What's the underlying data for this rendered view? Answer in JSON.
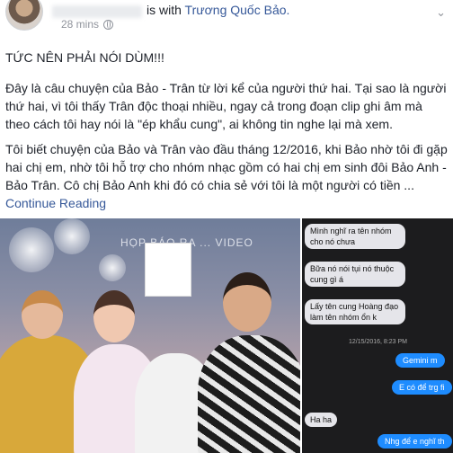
{
  "header": {
    "with_text": "is with",
    "tagged_name": "Trương Quốc Bảo.",
    "time": "28 mins"
  },
  "post": {
    "title": "TỨC NÊN PHẢI NÓI DÙM!!!",
    "para1": "Đây là câu chuyện của Bảo - Trân từ lời kể của người thứ hai. Tại sao là người thứ hai, vì tôi thấy Trân độc thoại nhiều, ngay cả trong đoạn clip ghi âm mà theo cách tôi hay nói là \"ép khẩu cung\", ai không tin nghe lại mà xem.",
    "para2": "Tôi biết chuyện của Bảo và Trân vào đầu tháng 12/2016, khi Bảo nhờ tôi đi gặp hai chị em, nhờ tôi hỗ trợ cho nhóm nhạc gồm có hai chị em sinh đôi Bảo Anh - Bảo Trân. Cô chị Bảo Anh khi đó có chia sẻ với tôi là một người có tiền ...",
    "continue_label": "Continue Reading"
  },
  "photo": {
    "backdrop_text": "HỌP BÁO RA ... VIDEO"
  },
  "chat": {
    "messages_in": [
      "Mình nghĩ ra tên nhóm cho nó chưa",
      "Bữa nó nói tụi nó thuộc cung gì á",
      "Lấy tên cung Hoàng đạo làm tên nhóm ổn k",
      "Ha ha"
    ],
    "timestamp": "12/15/2016, 8:23 PM",
    "messages_out": [
      "Gemini m",
      "E có để trg fi",
      "Nhg để e nghĩ th"
    ]
  },
  "colors": {
    "link": "#365899",
    "outgoing_bubble": "#1e8cff",
    "chat_bg": "#1c1c1e"
  }
}
